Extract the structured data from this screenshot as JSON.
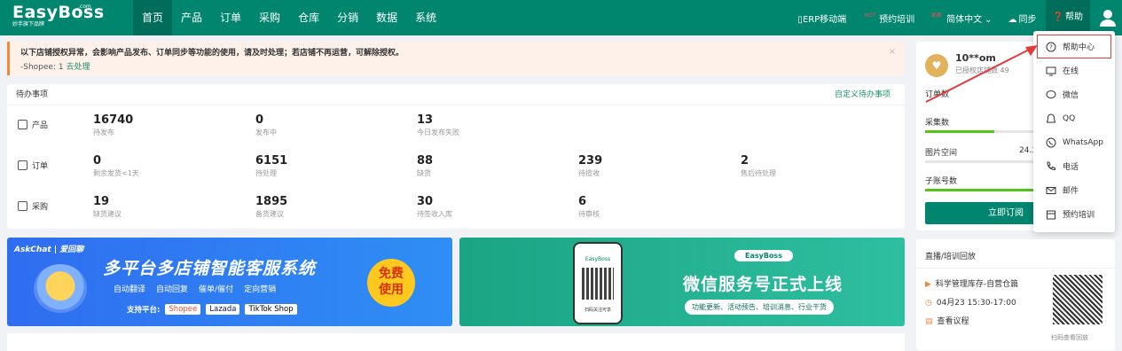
{
  "brand": {
    "name": "EasyBoss",
    "com": ".com",
    "tagline": "妙手旗下品牌"
  },
  "nav": [
    "首页",
    "产品",
    "订单",
    "采购",
    "仓库",
    "分销",
    "数据",
    "系统"
  ],
  "topright": {
    "erp": "ERP移动端",
    "hot": "HOT",
    "training": "预约培训",
    "free": "免费",
    "lang": "简体中文",
    "sync": "同步",
    "help": "帮助"
  },
  "alert": {
    "title": "以下店铺授权异常，会影响产品发布、订单同步等功能的使用，请及时处理；若店铺不再运营，可解除授权。",
    "shop": "-Shopee: 1",
    "action": "去处理"
  },
  "todo": {
    "title": "待办事项",
    "customize": "自定义待办事项",
    "rows": [
      {
        "label": "产品",
        "cells": [
          {
            "n": "16740",
            "d": "待发布"
          },
          {
            "n": "0",
            "d": "发布中"
          },
          {
            "n": "13",
            "d": "今日发布失败"
          }
        ]
      },
      {
        "label": "订单",
        "cells": [
          {
            "n": "0",
            "d": "剩余发货<1天"
          },
          {
            "n": "6151",
            "d": "待处理"
          },
          {
            "n": "88",
            "d": "缺货"
          },
          {
            "n": "239",
            "d": "待揽收"
          },
          {
            "n": "2",
            "d": "售后待处理"
          }
        ]
      },
      {
        "label": "采购",
        "cells": [
          {
            "n": "19",
            "d": "缺货建议"
          },
          {
            "n": "1895",
            "d": "备货建议"
          },
          {
            "n": "30",
            "d": "待签收入库"
          },
          {
            "n": "6",
            "d": "待审核"
          }
        ]
      }
    ]
  },
  "banner1": {
    "brand": "AskChat | 爱回聊",
    "title": "多平台多店铺智能客服系统",
    "features": [
      "自动翻译",
      "自动回复",
      "催单/催付",
      "定向营销"
    ],
    "support": "支持平台:",
    "platforms": [
      "Shopee",
      "Lazada",
      "TikTok Shop"
    ],
    "badge": [
      "免费",
      "使用"
    ]
  },
  "banner2": {
    "brand": "EasyBoss",
    "title": "微信服务号正式上线",
    "sub": "功能更新、活动预告、培训消息、行业干货",
    "scan": "扫码关注可享"
  },
  "account": {
    "name": "10**om",
    "sub": "已授权店铺数 49",
    "orders": "订单数",
    "collect": "采集数",
    "space": "图片空间",
    "space_val": "24.3",
    "sub_acc": "子账号数",
    "buy": "立即订阅"
  },
  "live": {
    "title": "直播/培训回放",
    "item": "科学管理库存-自营仓篇",
    "time": "04月23 15:30-17:00",
    "agenda": "查看议程",
    "qr_caption": "扫码查看回放"
  },
  "help_menu": [
    "帮助中心",
    "在线",
    "微信",
    "QQ",
    "WhatsApp",
    "电话",
    "邮件",
    "预约培训"
  ]
}
